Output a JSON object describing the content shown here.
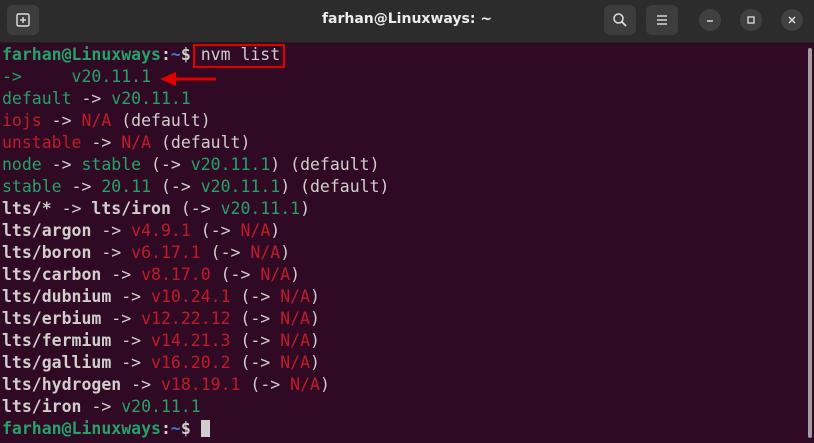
{
  "window": {
    "title": "farhan@Linuxways: ~",
    "new_tab_icon": "new-tab-icon",
    "search_icon": "search-icon",
    "menu_icon": "hamburger-menu-icon",
    "minimize_icon": "minimize-icon",
    "maximize_icon": "maximize-icon",
    "close_icon": "close-icon"
  },
  "prompt": {
    "user_host": "farhan@Linuxways",
    "sep": ":",
    "path": "~",
    "symbol": "$ "
  },
  "command": "nvm list",
  "lines": {
    "l1": {
      "arrow": "->     ",
      "ver": "v20.11.1"
    },
    "l2": {
      "name": "default",
      "arr": " -> ",
      "ver": "v20.11.1"
    },
    "l3": {
      "name": "iojs",
      "arr": " -> ",
      "val": "N/A",
      "tail": " (default)"
    },
    "l4": {
      "name": "unstable",
      "arr": " -> ",
      "val": "N/A",
      "tail": " (default)"
    },
    "l5": {
      "name": "node",
      "arr": " -> ",
      "val": "stable",
      "p1": " (",
      "arr2": "->",
      "ver": " v20.11.1",
      "p2": ") (default)"
    },
    "l6": {
      "name": "stable",
      "arr": " -> ",
      "val": "20.11",
      "p1": " (",
      "arr2": "->",
      "ver": " v20.11.1",
      "p2": ") (default)"
    },
    "l7": {
      "name": "lts/*",
      "arr": " -> ",
      "val": "lts/iron",
      "p1": " (",
      "arr2": "->",
      "ver": " v20.11.1",
      "p2": ")"
    },
    "l8": {
      "name": "lts/argon",
      "arr": " -> ",
      "val": "v4.9.1",
      "p1": " (",
      "arr2": "->",
      "na": " N/A",
      "p2": ")"
    },
    "l9": {
      "name": "lts/boron",
      "arr": " -> ",
      "val": "v6.17.1",
      "p1": " (",
      "arr2": "->",
      "na": " N/A",
      "p2": ")"
    },
    "l10": {
      "name": "lts/carbon",
      "arr": " -> ",
      "val": "v8.17.0",
      "p1": " (",
      "arr2": "->",
      "na": " N/A",
      "p2": ")"
    },
    "l11": {
      "name": "lts/dubnium",
      "arr": " -> ",
      "val": "v10.24.1",
      "p1": " (",
      "arr2": "->",
      "na": " N/A",
      "p2": ")"
    },
    "l12": {
      "name": "lts/erbium",
      "arr": " -> ",
      "val": "v12.22.12",
      "p1": " (",
      "arr2": "->",
      "na": " N/A",
      "p2": ")"
    },
    "l13": {
      "name": "lts/fermium",
      "arr": " -> ",
      "val": "v14.21.3",
      "p1": " (",
      "arr2": "->",
      "na": " N/A",
      "p2": ")"
    },
    "l14": {
      "name": "lts/gallium",
      "arr": " -> ",
      "val": "v16.20.2",
      "p1": " (",
      "arr2": "->",
      "na": " N/A",
      "p2": ")"
    },
    "l15": {
      "name": "lts/hydrogen",
      "arr": " -> ",
      "val": "v18.19.1",
      "p1": " (",
      "arr2": "->",
      "na": " N/A",
      "p2": ")"
    },
    "l16": {
      "name": "lts/iron",
      "arr": " -> ",
      "ver": "v20.11.1"
    }
  },
  "colors": {
    "background": "#300a24",
    "green": "#26a269",
    "red": "#c01c28",
    "highlight_box": "#e00000"
  }
}
